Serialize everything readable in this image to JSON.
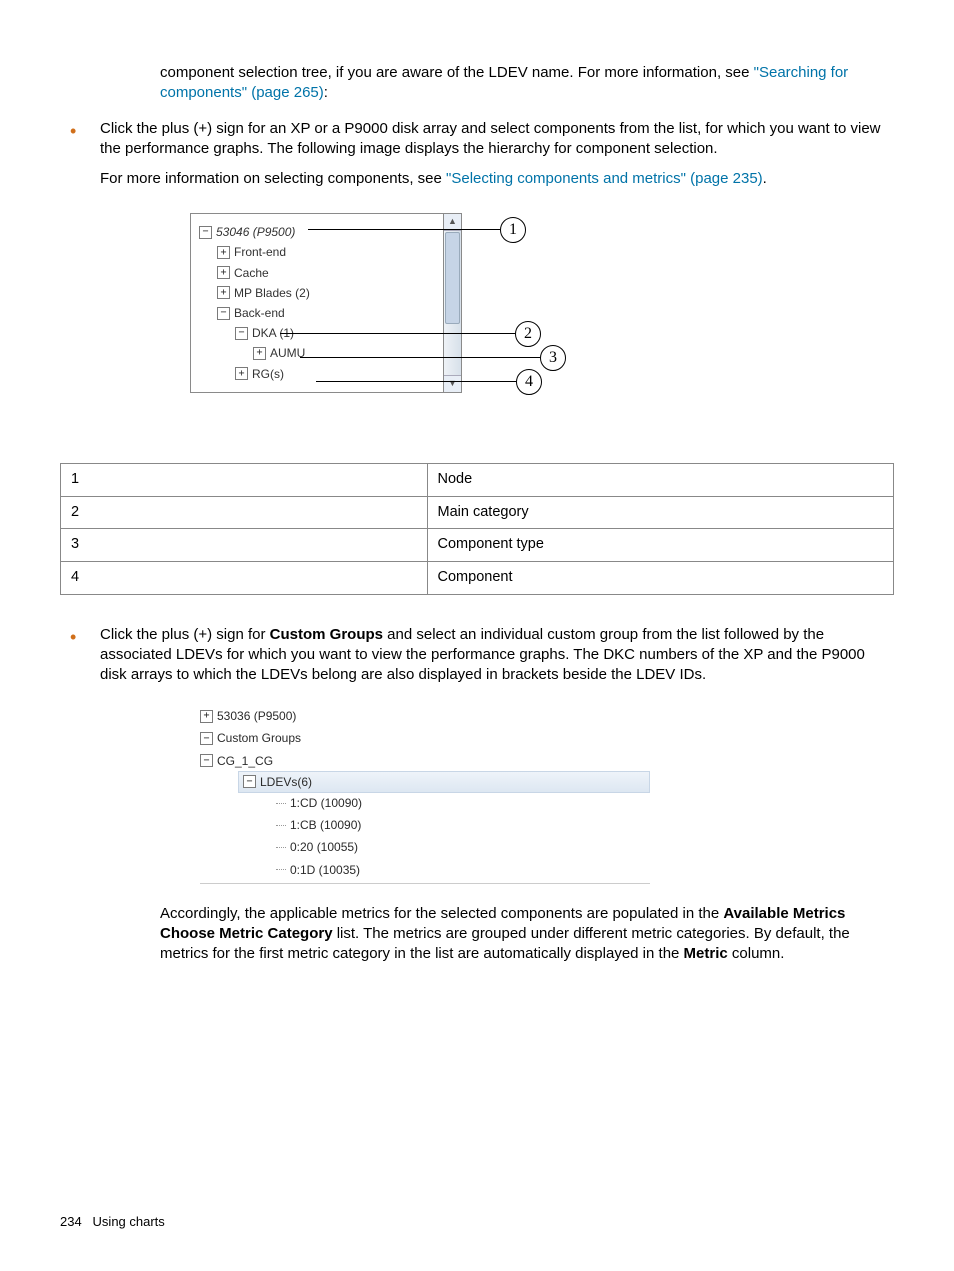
{
  "intro": {
    "line1a": "component selection tree, if you are aware of the LDEV name. For more information, see ",
    "link1": "\"Searching for components\" (page 265)",
    "line1b": ":"
  },
  "bul1": {
    "p1": "Click the plus (+) sign for an XP or a P9000 disk array and select components from the list, for which you want to view the performance graphs. The following image displays the hierarchy for component selection.",
    "p2a": "For more information on selecting components, see ",
    "p2link": "\"Selecting components and metrics\" (page 235)",
    "p2b": "."
  },
  "tree1": {
    "root": "53046 (P9500)",
    "frontend": "Front-end",
    "cache": "Cache",
    "mp": "MP Blades (2)",
    "backend": "Back-end",
    "dka": "DKA (1)",
    "aumu": "AUMU",
    "rgs": "RG(s)"
  },
  "callouts": {
    "c1": "1",
    "c2": "2",
    "c3": "3",
    "c4": "4"
  },
  "table": {
    "r1n": "1",
    "r1d": "Node",
    "r2n": "2",
    "r2d": "Main category",
    "r3n": "3",
    "r3d": "Component type",
    "r4n": "4",
    "r4d": "Component"
  },
  "bul2": {
    "p_a": "Click the plus (+) sign for ",
    "p_b": "Custom Groups",
    "p_c": " and select an individual custom group from the list followed by the associated LDEVs for which you want to view the performance graphs. The DKC numbers of the XP and the P9000 disk arrays to which the LDEVs belong are also displayed in brackets beside the LDEV IDs."
  },
  "tree2": {
    "root": "53036 (P9500)",
    "cg": "Custom Groups",
    "cg1": "CG_1_CG",
    "ldevs": "LDEVs(6)",
    "l1": "1:CD (10090)",
    "l2": "1:CB (10090)",
    "l3": "0:20 (10055)",
    "l4": "0:1D (10035)"
  },
  "closing": {
    "a": "Accordingly, the applicable metrics for the selected components are populated in the ",
    "b": "Available Metrics Choose Metric Category",
    "c": " list. The metrics are grouped under different metric categories. By default, the metrics for the first metric category in the list are automatically displayed in the ",
    "d": "Metric",
    "e": " column."
  },
  "footer": {
    "page": "234",
    "section": "Using charts"
  }
}
